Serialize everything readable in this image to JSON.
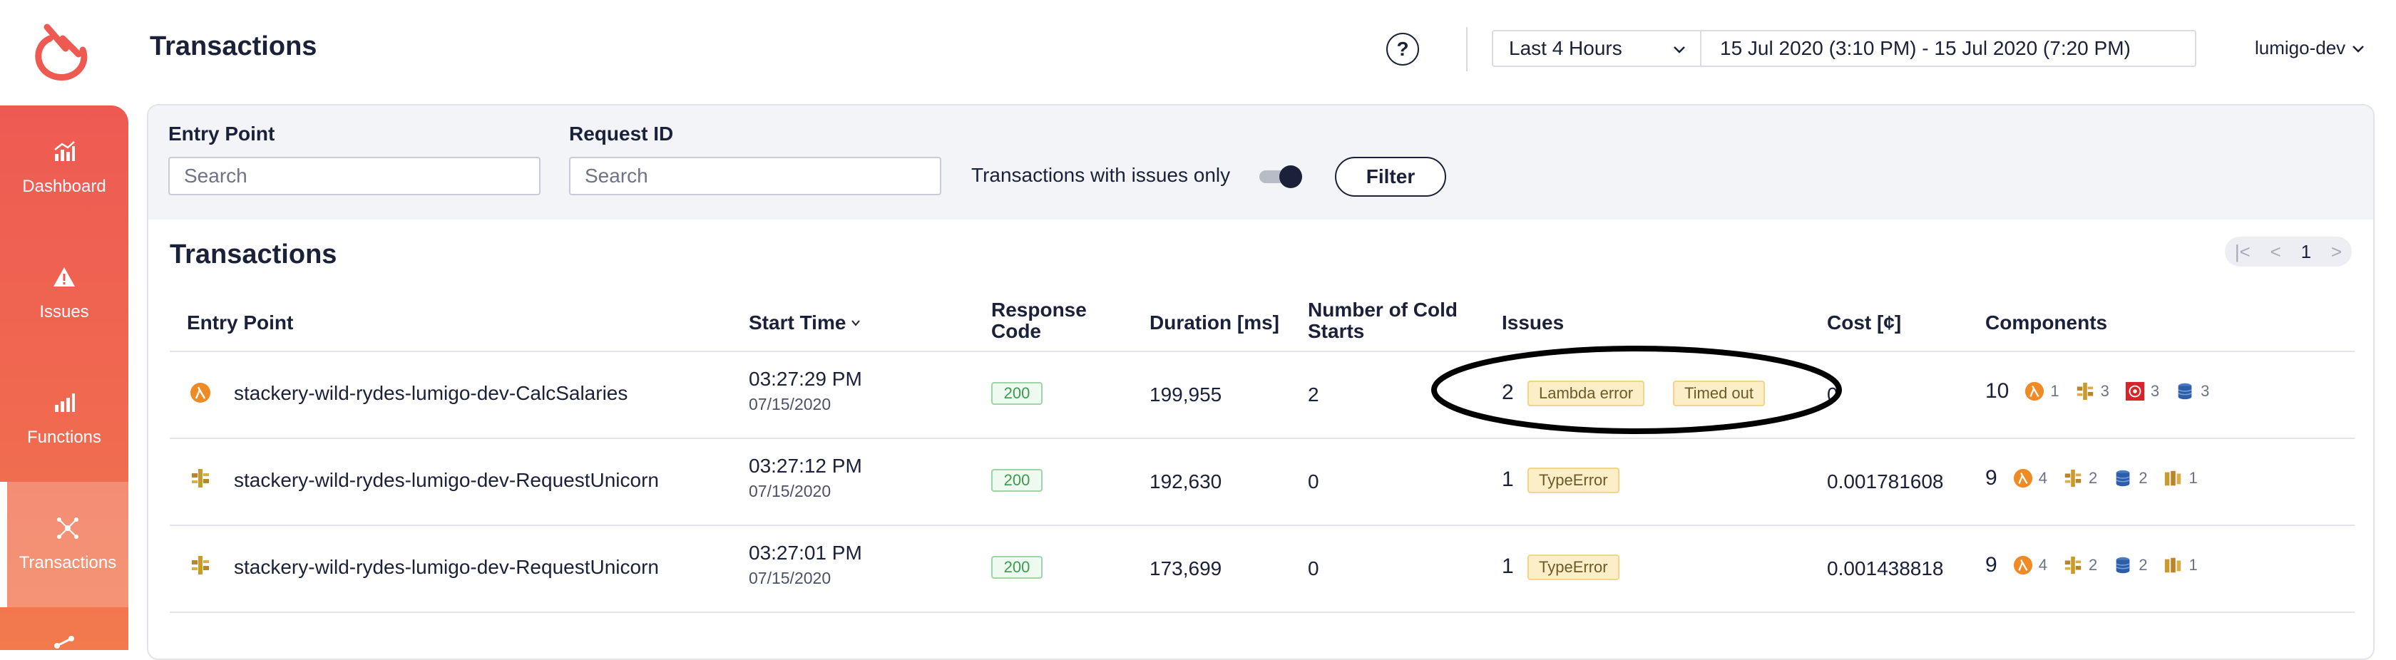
{
  "app": {
    "title": "Transactions",
    "help_label": "?",
    "time_range": {
      "selected": "Last 4 Hours",
      "range_text": "15 Jul 2020 (3:10 PM) - 15 Jul 2020 (7:20 PM)"
    },
    "account": "lumigo-dev",
    "brand_color": "#ee5a52"
  },
  "sidebar": {
    "items": [
      {
        "label": "Dashboard",
        "icon": "dashboard-chart-icon",
        "active": false
      },
      {
        "label": "Issues",
        "icon": "warning-triangle-icon",
        "active": false
      },
      {
        "label": "Functions",
        "icon": "functions-chart-icon",
        "active": false
      },
      {
        "label": "Transactions",
        "icon": "transactions-network-icon",
        "active": true
      }
    ]
  },
  "filters": {
    "entry_point_label": "Entry Point",
    "entry_point_placeholder": "Search",
    "request_id_label": "Request ID",
    "request_id_placeholder": "Search",
    "issues_only_label": "Transactions with issues only",
    "issues_only_on": true,
    "filter_button": "Filter"
  },
  "transactions": {
    "title": "Transactions",
    "pager": {
      "first": "|<",
      "prev": "<",
      "page": "1",
      "next": ">"
    },
    "columns": {
      "entry_point": "Entry Point",
      "start_time": "Start Time",
      "response_code_1": "Response",
      "response_code_2": "Code",
      "duration": "Duration [ms]",
      "cold_starts_1": "Number of Cold",
      "cold_starts_2": "Starts",
      "issues": "Issues",
      "cost": "Cost [¢]",
      "components": "Components"
    },
    "rows": [
      {
        "entry_icon": "lambda-icon",
        "entry_point": "stackery-wild-rydes-lumigo-dev-CalcSalaries",
        "start_time": "03:27:29 PM",
        "start_date": "07/15/2020",
        "response_code": "200",
        "duration": "199,955",
        "cold_starts": "2",
        "issue_count": "2",
        "issues": [
          "Lambda error",
          "Timed out"
        ],
        "cost": "0",
        "components_total": "10",
        "components": [
          {
            "icon": "lambda-icon",
            "count": "1"
          },
          {
            "icon": "api-gateway-icon",
            "count": "3"
          },
          {
            "icon": "sns-icon",
            "count": "3"
          },
          {
            "icon": "dynamodb-icon",
            "count": "3"
          }
        ]
      },
      {
        "entry_icon": "api-gateway-icon",
        "entry_point": "stackery-wild-rydes-lumigo-dev-RequestUnicorn",
        "start_time": "03:27:12 PM",
        "start_date": "07/15/2020",
        "response_code": "200",
        "duration": "192,630",
        "cold_starts": "0",
        "issue_count": "1",
        "issues": [
          "TypeError"
        ],
        "cost": "0.001781608",
        "components_total": "9",
        "components": [
          {
            "icon": "lambda-icon",
            "count": "4"
          },
          {
            "icon": "api-gateway-icon",
            "count": "2"
          },
          {
            "icon": "dynamodb-icon",
            "count": "2"
          },
          {
            "icon": "kinesis-icon",
            "count": "1"
          }
        ]
      },
      {
        "entry_icon": "api-gateway-icon",
        "entry_point": "stackery-wild-rydes-lumigo-dev-RequestUnicorn",
        "start_time": "03:27:01 PM",
        "start_date": "07/15/2020",
        "response_code": "200",
        "duration": "173,699",
        "cold_starts": "0",
        "issue_count": "1",
        "issues": [
          "TypeError"
        ],
        "cost": "0.001438818",
        "components_total": "9",
        "components": [
          {
            "icon": "lambda-icon",
            "count": "4"
          },
          {
            "icon": "api-gateway-icon",
            "count": "2"
          },
          {
            "icon": "dynamodb-icon",
            "count": "2"
          },
          {
            "icon": "kinesis-icon",
            "count": "1"
          }
        ]
      }
    ]
  }
}
